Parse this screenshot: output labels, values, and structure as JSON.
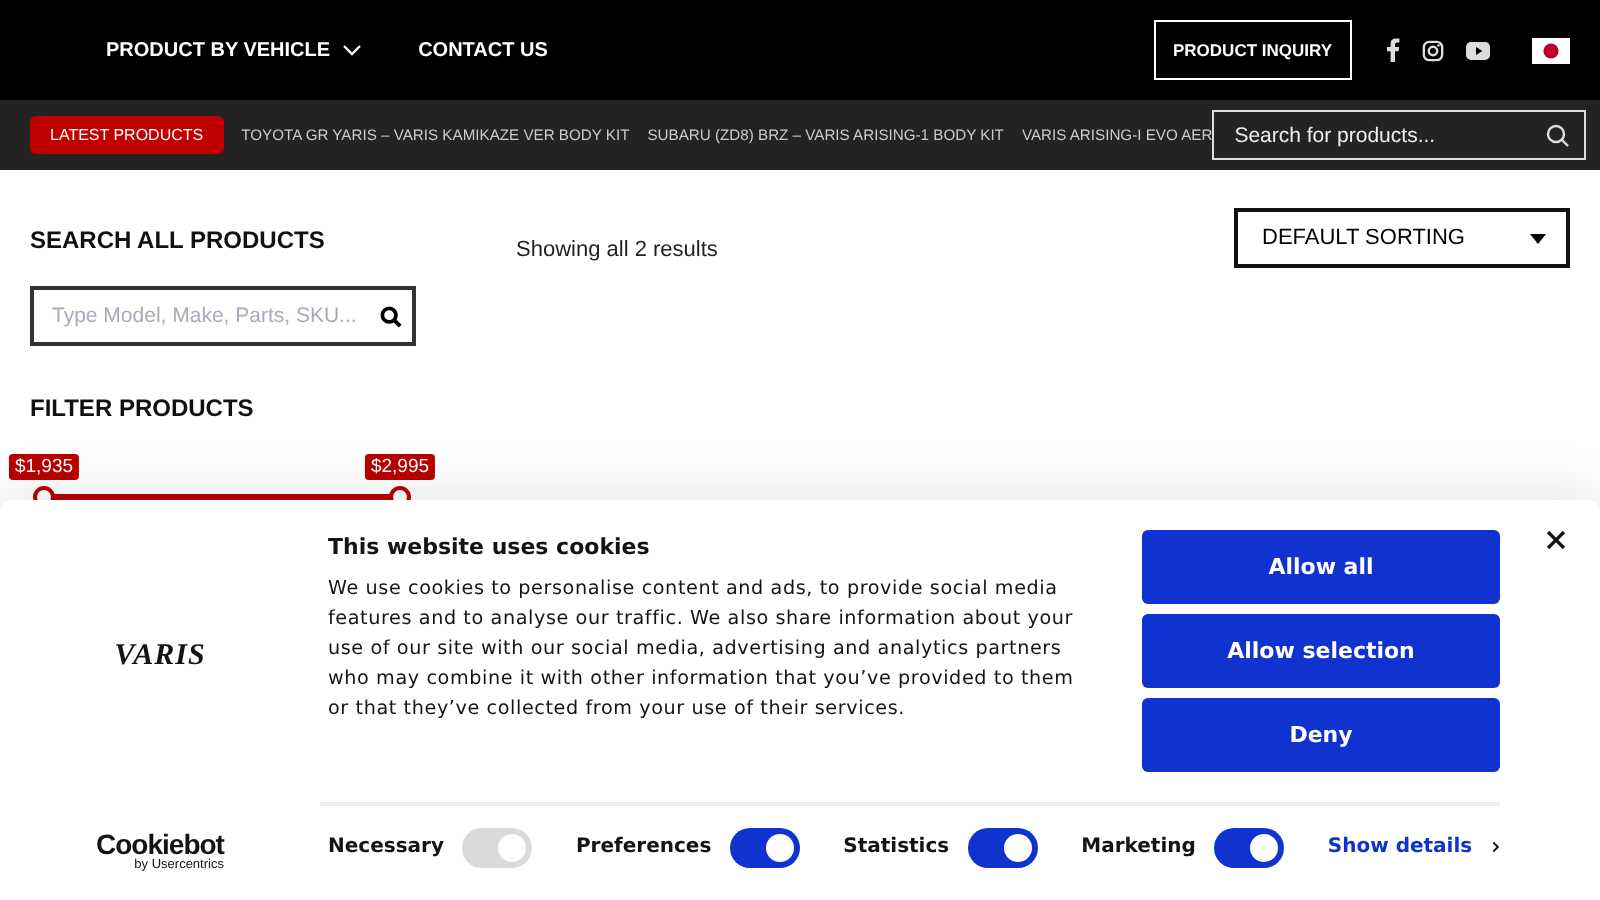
{
  "header": {
    "nav": [
      {
        "label": "PRODUCT BY VEHICLE",
        "dropdown": true
      },
      {
        "label": "CONTACT US",
        "dropdown": false
      }
    ],
    "inquiry_button": "PRODUCT INQUIRY"
  },
  "ticker": {
    "badge": "LATEST PRODUCTS",
    "items": [
      "TOYOTA GR YARIS – VARIS KAMIKAZE VER BODY KIT",
      "SUBARU (ZD8) BRZ – VARIS ARISING-1 BODY KIT",
      "VARIS ARISING-I EVO AER"
    ],
    "search": {
      "placeholder": "Search for products..."
    }
  },
  "sidebar": {
    "search_title": "SEARCH ALL PRODUCTS",
    "search": {
      "placeholder": "Type Model, Make, Parts, SKU..."
    },
    "filter_title": "FILTER PRODUCTS",
    "price_slider": [
      {
        "label": "$1,935",
        "level": 0
      },
      {
        "label": "$2,995",
        "level": 1
      }
    ]
  },
  "results": {
    "count_text": "Showing all 2 results",
    "sorting": "DEFAULT SORTING"
  },
  "cookie_banner": {
    "logo": "VARIS",
    "title": "This website uses cookies",
    "body": "We use cookies to personalise content and ads, to provide social media features and to analyse our traffic. We also share information about your use of our site with our social media, advertising and analytics partners who may combine it with other information that you’ve provided to them or that they’ve collected from your use of their services.",
    "buttons": [
      "Allow all",
      "Allow selection",
      "Deny"
    ],
    "brand": "Cookiebot",
    "brand_sub": "by Usercentrics",
    "toggles": [
      {
        "label": "Necessary",
        "on": true,
        "disabled": true
      },
      {
        "label": "Preferences",
        "on": true,
        "disabled": false
      },
      {
        "label": "Statistics",
        "on": true,
        "disabled": false
      },
      {
        "label": "Marketing",
        "on": true,
        "disabled": false
      }
    ],
    "details_link": "Show details"
  }
}
